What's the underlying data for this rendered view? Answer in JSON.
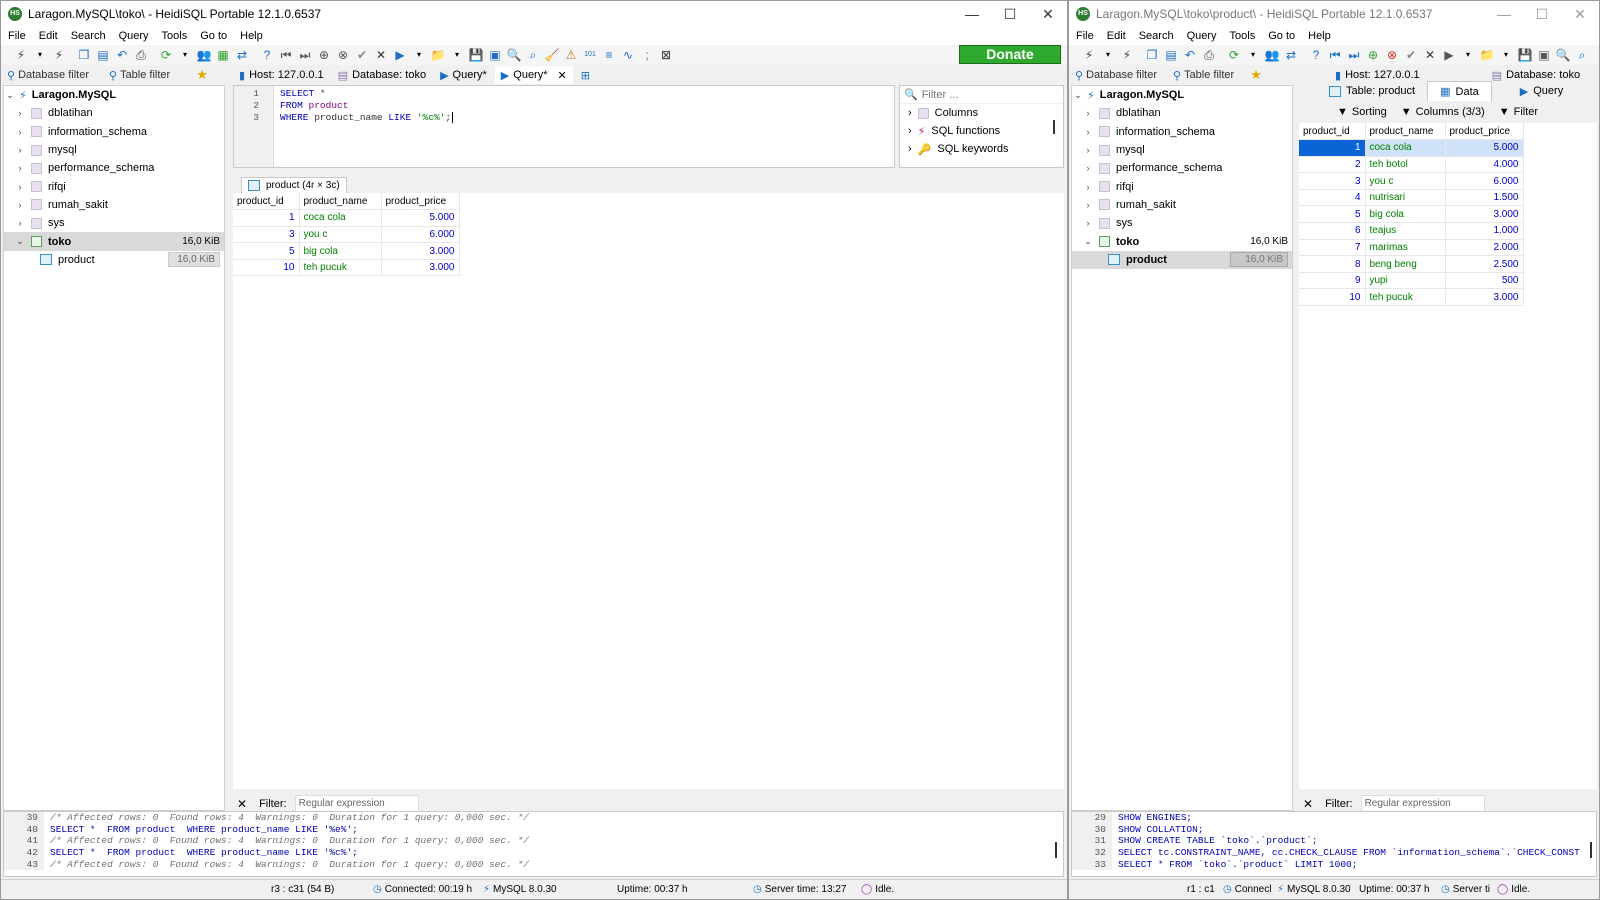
{
  "left": {
    "title": "Laragon.MySQL\\toko\\ - HeidiSQL Portable 12.1.0.6537",
    "menu": [
      "File",
      "Edit",
      "Search",
      "Query",
      "Tools",
      "Go to",
      "Help"
    ],
    "donate": "Donate",
    "db_filter": "Database filter",
    "table_filter": "Table filter",
    "tabs": {
      "host": "Host: 127.0.0.1",
      "database": "Database: toko",
      "query1": "Query*",
      "query2": "Query*"
    },
    "tree": {
      "root": "Laragon.MySQL",
      "dbs": [
        "dblatihan",
        "information_schema",
        "mysql",
        "performance_schema",
        "rifqi",
        "rumah_sakit",
        "sys"
      ],
      "selected_db": "toko",
      "selected_db_size": "16,0 KiB",
      "table": "product",
      "table_size": "16,0 KiB"
    },
    "editor": {
      "line_numbers": [
        "1",
        "2",
        "3"
      ],
      "lines": [
        {
          "k": "SELECT",
          "r": " *"
        },
        {
          "k": "FROM",
          "id": " product"
        },
        {
          "k": "WHERE",
          "r": " product_name ",
          "k2": "LIKE",
          "s": " '%c%'",
          "end": ";"
        }
      ]
    },
    "helper": {
      "filter_placeholder": "Filter ...",
      "items": [
        "Columns",
        "SQL functions",
        "SQL keywords"
      ]
    },
    "result_tab": "product (4r × 3c)",
    "grid": {
      "headers": [
        "product_id",
        "product_name",
        "product_price"
      ],
      "rows": [
        [
          "1",
          "coca cola",
          "5.000"
        ],
        [
          "3",
          "you c",
          "6.000"
        ],
        [
          "5",
          "big cola",
          "3.000"
        ],
        [
          "10",
          "teh pucuk",
          "3.000"
        ]
      ]
    },
    "filter_label": "Filter:",
    "filter_placeholder": "Regular expression",
    "log": [
      {
        "n": "39",
        "t": "/* Affected rows: 0  Found rows: 4  Warnings: 0  Duration for 1 query: 0,000 sec. */",
        "c": true
      },
      {
        "n": "40",
        "t": "SELECT *  FROM product  WHERE product_name LIKE '%e%';",
        "c": false
      },
      {
        "n": "41",
        "t": "/* Affected rows: 0  Found rows: 4  Warnings: 0  Duration for 1 query: 0,000 sec. */",
        "c": true
      },
      {
        "n": "42",
        "t": "SELECT *  FROM product  WHERE product_name LIKE '%c%';",
        "c": false
      },
      {
        "n": "43",
        "t": "/* Affected rows: 0  Found rows: 4  Warnings: 0  Duration for 1 query: 0,000 sec. */",
        "c": true
      }
    ],
    "status": {
      "cursor": "r3 : c31 (54 B)",
      "connected": "Connected: 00:19 h",
      "version": "MySQL 8.0.30",
      "uptime": "Uptime: 00:37 h",
      "server_time": "Server time: 13:27",
      "state": "Idle."
    }
  },
  "right": {
    "title": "Laragon.MySQL\\toko\\product\\ - HeidiSQL Portable 12.1.0.6537",
    "menu": [
      "File",
      "Edit",
      "Search",
      "Query",
      "Tools",
      "Go to",
      "Help"
    ],
    "db_filter": "Database filter",
    "table_filter": "Table filter",
    "host": "Host: 127.0.0.1",
    "database": "Database: toko",
    "tab_table": "Table: product",
    "tab_data": "Data",
    "tab_query": "Query",
    "sorting": "Sorting",
    "columns": "Columns (3/3)",
    "filter": "Filter",
    "tree": {
      "root": "Laragon.MySQL",
      "dbs": [
        "dblatihan",
        "information_schema",
        "mysql",
        "performance_schema",
        "rifqi",
        "rumah_sakit",
        "sys"
      ],
      "selected_db": "toko",
      "selected_db_size": "16,0 KiB",
      "table": "product",
      "table_size": "16,0 KiB"
    },
    "grid": {
      "headers": [
        "product_id",
        "product_name",
        "product_price"
      ],
      "rows": [
        [
          "1",
          "coca cola",
          "5.000"
        ],
        [
          "2",
          "teh botol",
          "4.000"
        ],
        [
          "3",
          "you c",
          "6.000"
        ],
        [
          "4",
          "nutrisari",
          "1.500"
        ],
        [
          "5",
          "big cola",
          "3.000"
        ],
        [
          "6",
          "teajus",
          "1.000"
        ],
        [
          "7",
          "marimas",
          "2.000"
        ],
        [
          "8",
          "beng beng",
          "2.500"
        ],
        [
          "9",
          "yupi",
          "500"
        ],
        [
          "10",
          "teh pucuk",
          "3.000"
        ]
      ]
    },
    "filter_label": "Filter:",
    "filter_placeholder": "Regular expression",
    "log": [
      {
        "n": "29",
        "t": "SHOW ENGINES;"
      },
      {
        "n": "30",
        "t": "SHOW COLLATION;"
      },
      {
        "n": "31",
        "t": "SHOW CREATE TABLE `toko`.`product`;"
      },
      {
        "n": "32",
        "t": "SELECT tc.CONSTRAINT_NAME, cc.CHECK_CLAUSE FROM `information_schema`.`CHECK_CONST"
      },
      {
        "n": "33",
        "t": "SELECT * FROM `toko`.`product` LIMIT 1000;"
      }
    ],
    "status": {
      "cursor": "r1 : c1",
      "connected": "Connecl",
      "version": "MySQL 8.0.30",
      "uptime": "Uptime: 00:37 h",
      "server_time": "Server ti",
      "state": "Idle."
    }
  }
}
